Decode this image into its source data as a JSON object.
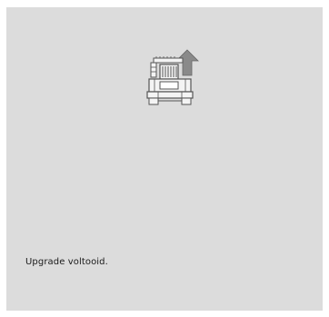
{
  "screen": {
    "icon": "machine-upgrade-icon",
    "message": "Upgrade voltooid."
  },
  "colors": {
    "background": "#dcdcdc",
    "icon_stroke": "#555555",
    "icon_fill_light": "#f4f4f4",
    "icon_fill_dark": "#8a8a8a",
    "text": "#1a1a1a"
  }
}
